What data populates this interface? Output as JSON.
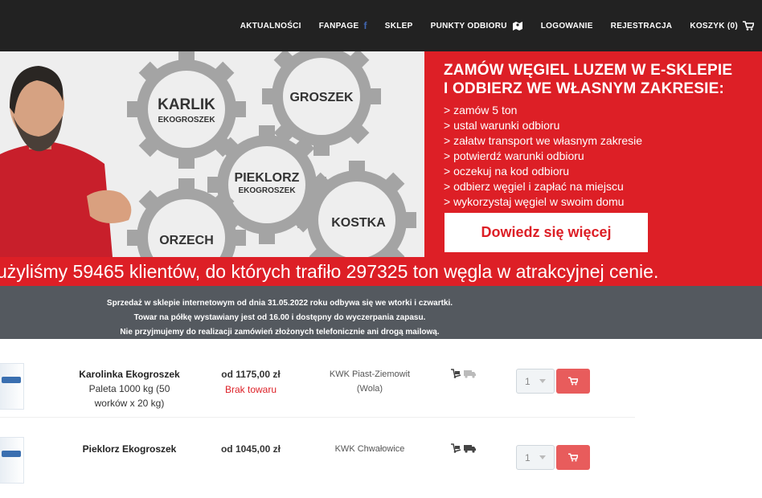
{
  "nav": {
    "items": [
      {
        "label": "AKTUALNOŚCI"
      },
      {
        "label": "FANPAGE",
        "icon": "facebook-icon",
        "icon_glyph": "f"
      },
      {
        "label": "SKLEP"
      },
      {
        "label": "PUNKTY ODBIORU",
        "icon": "map-icon"
      },
      {
        "label": "LOGOWANIE"
      },
      {
        "label": "REJESTRACJA"
      },
      {
        "label": "KOSZYK (0)",
        "icon": "cart-icon"
      }
    ]
  },
  "banner": {
    "gears": [
      "KARLIK",
      "EKOGROSZEK",
      "GROSZEK",
      "PIEKLORZ",
      "EKOGROSZEK",
      "KOSTKA",
      "ORZECH"
    ],
    "headline_1": "ZAMÓW WĘGIEL LUZEM W E-SKLEPIE",
    "headline_2": "I ODBIERZ WE WŁASNYM ZAKRESIE:",
    "steps": [
      "> zamów 5 ton",
      "> ustal warunki odbioru",
      "> załatw transport we własnym zakresie",
      "> potwierdź warunki odbioru",
      "> oczekuj na kod odbioru",
      "> odbierz węgiel i zapłać na miejscu",
      "> wykorzystaj węgiel w swoim domu"
    ],
    "button_label": "Dowiedz się więcej",
    "ticker": "użyliśmy 59465 klientów, do których trafiło 297325 ton węgla w atrakcyjnej cenie."
  },
  "notice": {
    "line_1": "Sprzedaż w sklepie internetowym od dnia 31.05.2022 roku odbywa się we wtorki i czwartki.",
    "line_2": "Towar na półkę wystawiany jest od 16.00 i dostępny do wyczerpania zapasu.",
    "line_3": "Nie przyjmujemy do realizacji zamówień złożonych telefonicznie ani drogą mailową."
  },
  "products": [
    {
      "name": "Karolinka Ekogroszek",
      "desc_1": "Paleta 1000 kg (50",
      "desc_2": "worków x 20 kg)",
      "price": "od 1175,00 zł",
      "status": "Brak towaru",
      "mine_1": "KWK Piast-Ziemowit",
      "mine_2": "(Wola)",
      "qty": "1"
    },
    {
      "name": "Pieklorz Ekogroszek",
      "price": "od 1045,00 zł",
      "mine_1": "KWK Chwałowice",
      "qty": "1"
    }
  ],
  "colors": {
    "accent": "#dd1f26",
    "topbar": "#222222",
    "notice_bg": "#54595f",
    "cart_button": "#e85c5c"
  }
}
